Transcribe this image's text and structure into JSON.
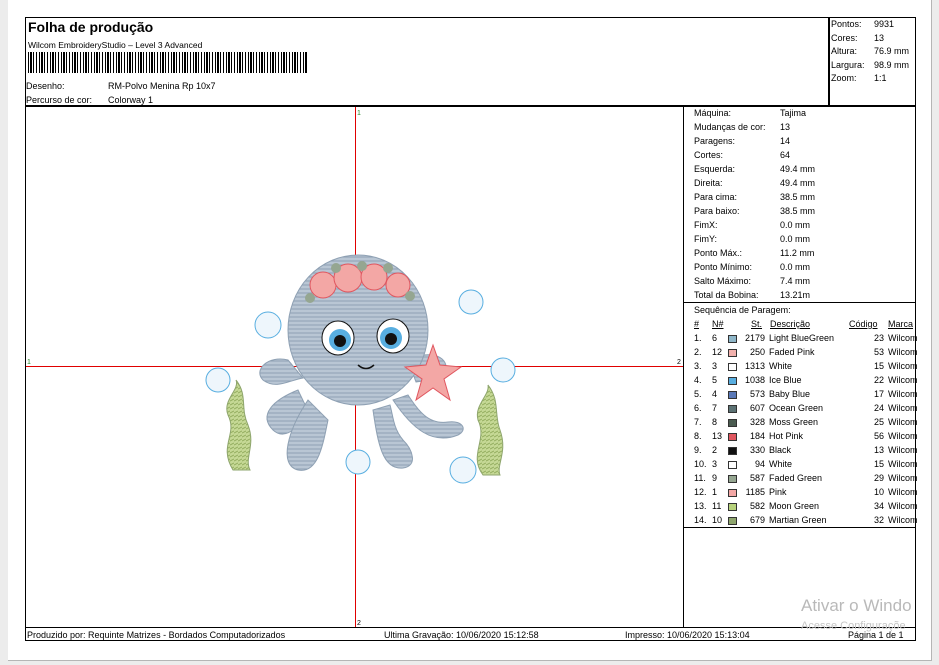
{
  "header": {
    "title": "Folha de produção",
    "subtitle": "Wilcom EmbroideryStudio – Level 3 Advanced",
    "design_label": "Desenho:",
    "design_value": "RM-Polvo Menina Rp 10x7",
    "colorway_label": "Percurso de cor:",
    "colorway_value": "Colorway 1"
  },
  "summary": [
    {
      "label": "Pontos:",
      "value": "9931"
    },
    {
      "label": "Cores:",
      "value": "13"
    },
    {
      "label": "Altura:",
      "value": "76.9 mm"
    },
    {
      "label": "Largura:",
      "value": "98.9 mm"
    },
    {
      "label": "Zoom:",
      "value": "1:1"
    }
  ],
  "stats": [
    {
      "label": "Máquina:",
      "value": "Tajima"
    },
    {
      "label": "Mudanças de cor:",
      "value": "13"
    },
    {
      "label": "Paragens:",
      "value": "14"
    },
    {
      "label": "Cortes:",
      "value": "64"
    },
    {
      "label": "Esquerda:",
      "value": "49.4 mm"
    },
    {
      "label": "Direita:",
      "value": "49.4 mm"
    },
    {
      "label": "Para cima:",
      "value": "38.5 mm"
    },
    {
      "label": "Para baixo:",
      "value": "38.5 mm"
    },
    {
      "label": "FimX:",
      "value": "0.0 mm"
    },
    {
      "label": "FimY:",
      "value": "0.0 mm"
    },
    {
      "label": "Ponto Máx.:",
      "value": "11.2 mm"
    },
    {
      "label": "Ponto Mínimo:",
      "value": "0.0 mm"
    },
    {
      "label": "Salto Máximo:",
      "value": "7.4 mm"
    },
    {
      "label": "Total da Bobina:",
      "value": "13.21m"
    }
  ],
  "sequence": {
    "title": "Sequência de Paragem:",
    "columns": [
      "#",
      "N#",
      "St.",
      "Descrição",
      "Código",
      "Marca"
    ],
    "rows": [
      {
        "idx": "1.",
        "n": "6",
        "st": "2179",
        "desc": "Light BlueGreen",
        "code": "23",
        "brand": "Wilcom",
        "color": "#8fb7c9"
      },
      {
        "idx": "2.",
        "n": "12",
        "st": "250",
        "desc": "Faded Pink",
        "code": "53",
        "brand": "Wilcom",
        "color": "#f2b1ad"
      },
      {
        "idx": "3.",
        "n": "3",
        "st": "1313",
        "desc": "White",
        "code": "15",
        "brand": "Wilcom",
        "color": "#ffffff"
      },
      {
        "idx": "4.",
        "n": "5",
        "st": "1038",
        "desc": "Ice Blue",
        "code": "22",
        "brand": "Wilcom",
        "color": "#58aee0"
      },
      {
        "idx": "5.",
        "n": "4",
        "st": "573",
        "desc": "Baby Blue",
        "code": "17",
        "brand": "Wilcom",
        "color": "#5a79b8"
      },
      {
        "idx": "6.",
        "n": "7",
        "st": "607",
        "desc": "Ocean Green",
        "code": "24",
        "brand": "Wilcom",
        "color": "#5c7274"
      },
      {
        "idx": "7.",
        "n": "8",
        "st": "328",
        "desc": "Moss Green",
        "code": "25",
        "brand": "Wilcom",
        "color": "#4a5b50"
      },
      {
        "idx": "8.",
        "n": "13",
        "st": "184",
        "desc": "Hot Pink",
        "code": "56",
        "brand": "Wilcom",
        "color": "#e0565f"
      },
      {
        "idx": "9.",
        "n": "2",
        "st": "330",
        "desc": "Black",
        "code": "13",
        "brand": "Wilcom",
        "color": "#111111"
      },
      {
        "idx": "10.",
        "n": "3",
        "st": "94",
        "desc": "White",
        "code": "15",
        "brand": "Wilcom",
        "color": "#ffffff"
      },
      {
        "idx": "11.",
        "n": "9",
        "st": "587",
        "desc": "Faded Green",
        "code": "29",
        "brand": "Wilcom",
        "color": "#95a691"
      },
      {
        "idx": "12.",
        "n": "1",
        "st": "1185",
        "desc": "Pink",
        "code": "10",
        "brand": "Wilcom",
        "color": "#f3a7a5"
      },
      {
        "idx": "13.",
        "n": "11",
        "st": "582",
        "desc": "Moon Green",
        "code": "34",
        "brand": "Wilcom",
        "color": "#b7d27c"
      },
      {
        "idx": "14.",
        "n": "10",
        "st": "679",
        "desc": "Martian Green",
        "code": "32",
        "brand": "Wilcom",
        "color": "#8ea56d"
      }
    ]
  },
  "axis_marks": {
    "top": "1",
    "left": "1",
    "right": "2",
    "bottom": "2"
  },
  "footer": {
    "produced_by": "Produzido por: Requinte Matrizes - Bordados Computadorizados",
    "last_saved": "Ultima Gravação: 10/06/2020 15:12:58",
    "printed": "Impresso: 10/06/2020 15:13:04",
    "page": "Página 1 de 1"
  },
  "watermark": {
    "line1": "Ativar o Windo",
    "line2": "Acesse Configuraçõe"
  }
}
